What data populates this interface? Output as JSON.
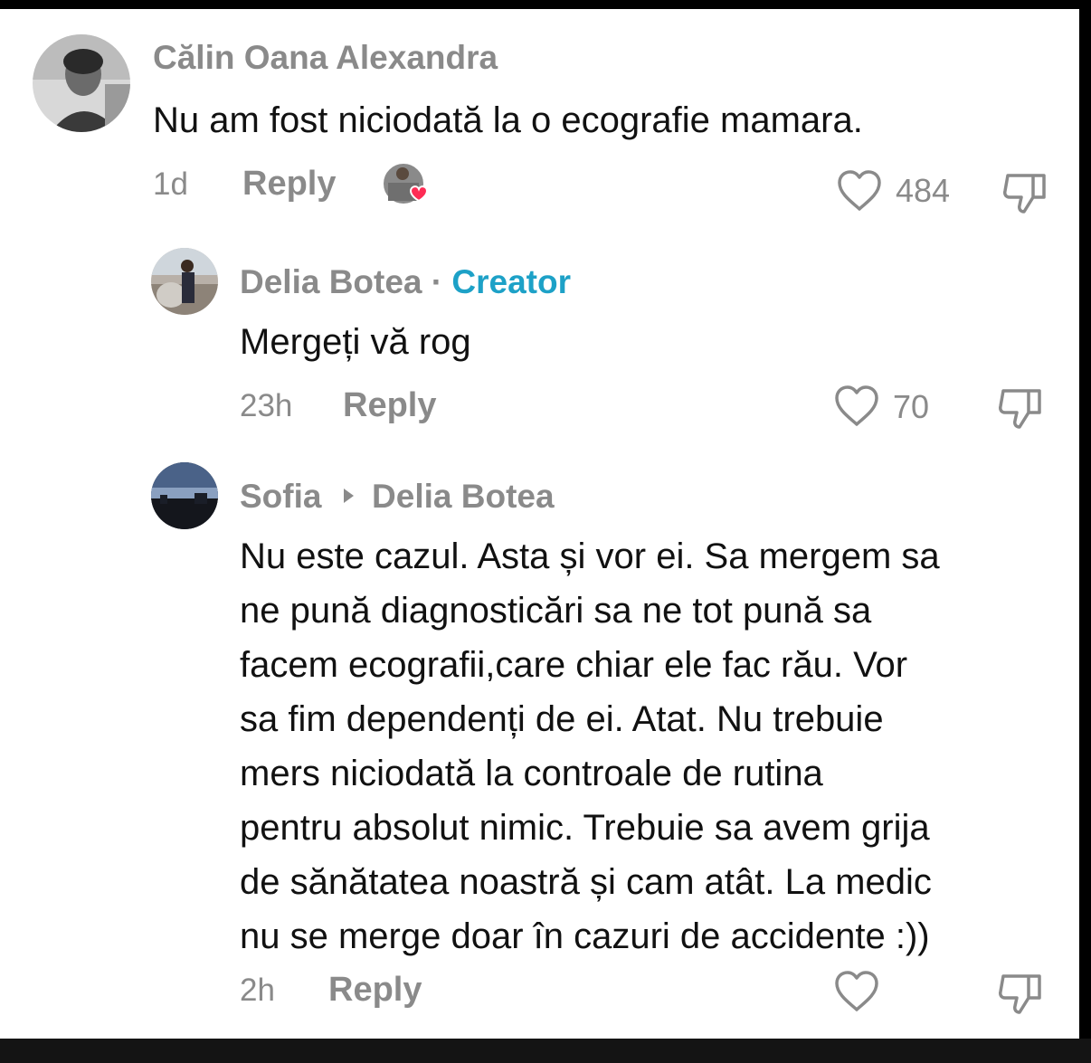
{
  "comments": [
    {
      "author": "Călin Oana Alexandra",
      "text": "Nu am fost niciodată la o ecografie mamara.",
      "time": "1d",
      "reply": "Reply",
      "likes": "484"
    },
    {
      "author": "Delia Botea",
      "separator": "·",
      "badge": "Creator",
      "text": "Mergeți vă rog",
      "time": "23h",
      "reply": "Reply",
      "likes": "70"
    },
    {
      "author": "Sofia",
      "reply_to": "Delia Botea",
      "text_lines": [
        "Nu este cazul. Asta și vor ei. Sa mergem sa",
        "ne pună diagnosticări sa ne tot pună sa",
        "facem ecografii,care chiar ele fac rău. Vor",
        "sa fim dependenți de ei. Atat. Nu trebuie",
        "mers niciodată la controale de rutina",
        "pentru absolut nimic. Trebuie sa avem grija",
        "de sănătatea noastră și cam atât. La medic",
        "nu se merge doar în cazuri de accidente :))"
      ],
      "time": "2h",
      "reply": "Reply",
      "likes": ""
    }
  ],
  "icons": {
    "like": "heart-outline-icon",
    "dislike": "thumbs-down-icon",
    "liked_by_creator": "heart-filled-icon",
    "reply_arrow": "triangle-right-icon"
  },
  "colors": {
    "creator_badge": "#1da1c7",
    "muted_text": "#8a8a8a",
    "body_text": "#111111",
    "heart_red": "#fe2c55"
  }
}
